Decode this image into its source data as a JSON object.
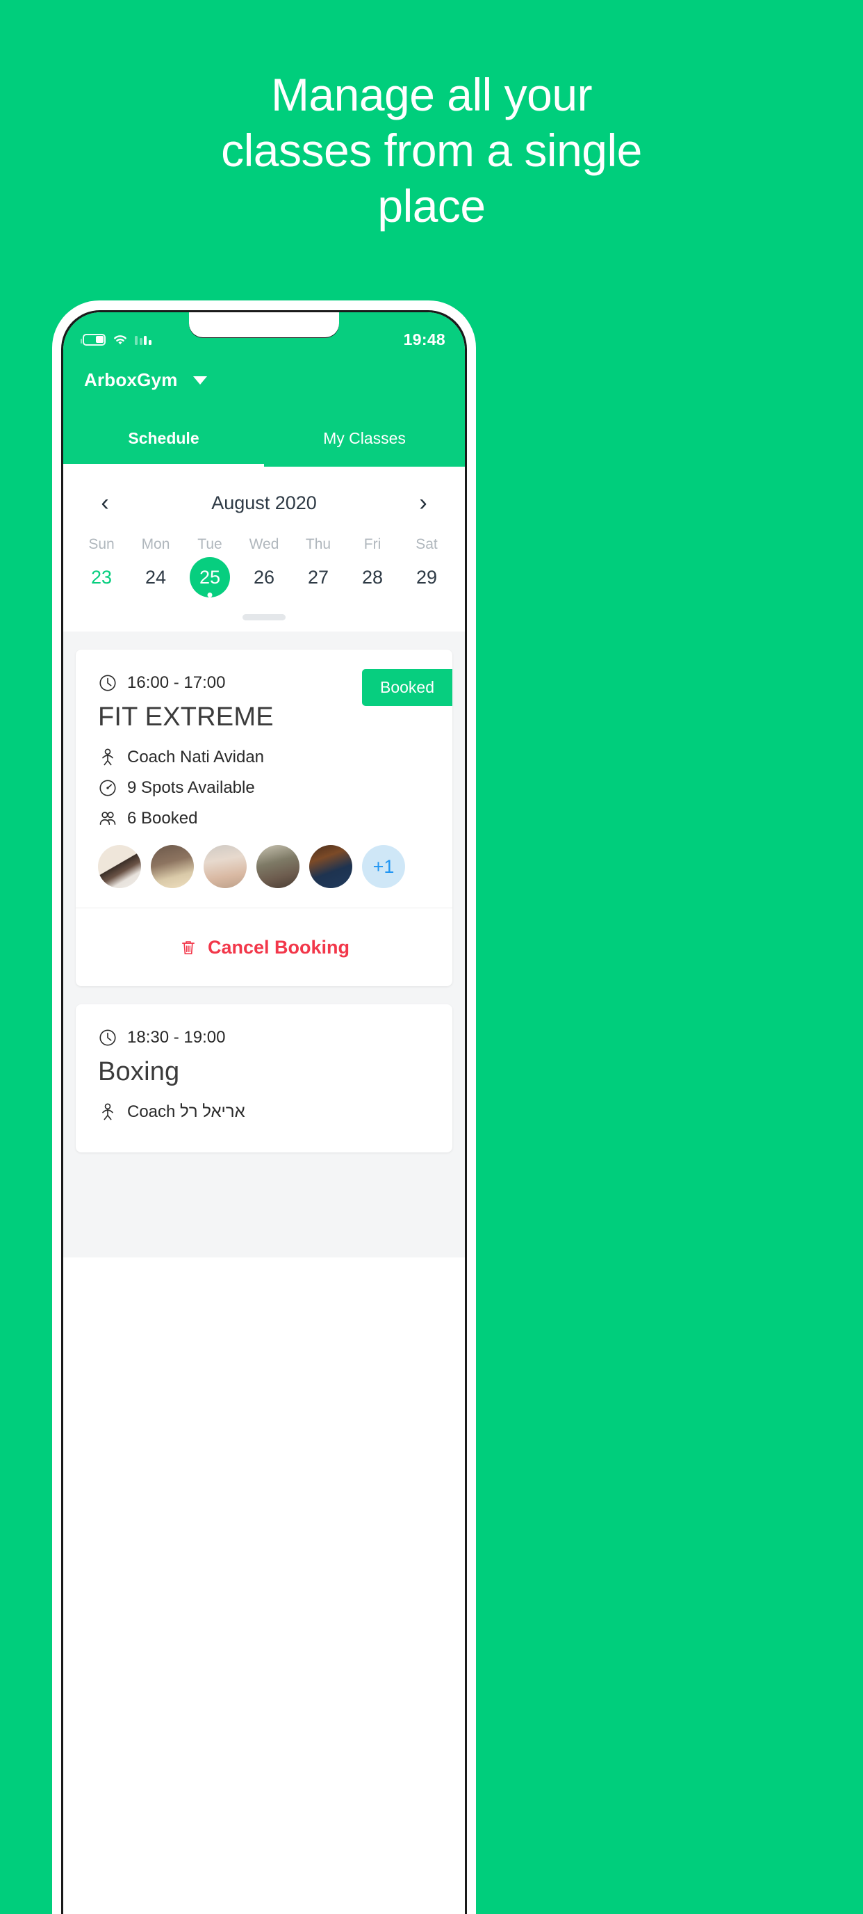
{
  "promo": {
    "headline_lines": [
      "Manage all your",
      "classes from a single",
      "place"
    ],
    "background_color": "#00CE7C"
  },
  "phone": {
    "status_bar": {
      "time": "19:48",
      "battery_icon": "battery-icon",
      "wifi_icon": "wifi-icon",
      "signal_icon": "signal-bars-icon"
    },
    "header": {
      "gym_name": "ArboxGym",
      "dropdown_icon": "chevron-down-icon",
      "accent_color": "#07CE7F"
    },
    "tabs": [
      {
        "label": "Schedule",
        "active": true
      },
      {
        "label": "My Classes",
        "active": false
      }
    ],
    "calendar": {
      "prev_icon": "chevron-left-icon",
      "next_icon": "chevron-right-icon",
      "month_label": "August 2020",
      "weekdays": [
        "Sun",
        "Mon",
        "Tue",
        "Wed",
        "Thu",
        "Fri",
        "Sat"
      ],
      "days": [
        {
          "num": "23",
          "state": "highlight"
        },
        {
          "num": "24",
          "state": "normal"
        },
        {
          "num": "25",
          "state": "selected"
        },
        {
          "num": "26",
          "state": "normal"
        },
        {
          "num": "27",
          "state": "normal"
        },
        {
          "num": "28",
          "state": "normal"
        },
        {
          "num": "29",
          "state": "normal"
        }
      ]
    },
    "classes": [
      {
        "time": "16:00 - 17:00",
        "time_icon": "clock-icon",
        "badge": "Booked",
        "title": "FIT EXTREME",
        "coach": "Coach Nati Avidan",
        "coach_icon": "coach-icon",
        "spots": "9 Spots Available",
        "spots_icon": "gauge-icon",
        "booked": "6 Booked",
        "booked_icon": "people-icon",
        "avatar_overflow": "+1",
        "action": {
          "label": "Cancel Booking",
          "icon": "trash-icon",
          "color": "#f2374a"
        }
      },
      {
        "time": "18:30 - 19:00",
        "time_icon": "clock-icon",
        "title": "Boxing",
        "coach": "Coach אריאל רל",
        "coach_icon": "coach-icon"
      }
    ]
  }
}
